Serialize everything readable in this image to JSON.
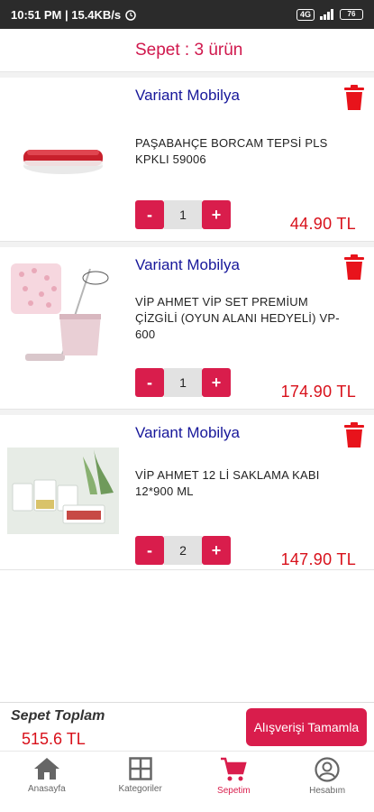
{
  "status_bar": {
    "time": "10:51 PM | 15.4KB/s",
    "network": "4G",
    "battery": "76"
  },
  "header": {
    "title": "Sepet : 3 ürün"
  },
  "cart_items": [
    {
      "seller": "Variant Mobilya",
      "name": "PAŞABAHÇE BORCAM TEPSİ PLS KPKLI 59006",
      "quantity": "1",
      "price": "44.90 TL",
      "minus_label": "-",
      "plus_label": "+"
    },
    {
      "seller": "Variant Mobilya",
      "name": "VİP AHMET VİP SET PREMİUM ÇİZGİLİ (OYUN ALANI HEDYELİ) VP-600",
      "quantity": "1",
      "price": "174.90 TL",
      "minus_label": "-",
      "plus_label": "+"
    },
    {
      "seller": "Variant Mobilya",
      "name": "VİP AHMET 12 Lİ SAKLAMA KABI 12*900 ML",
      "quantity": "2",
      "price": "147.90 TL",
      "minus_label": "-",
      "plus_label": "+"
    }
  ],
  "summary": {
    "label": "Sepet Toplam",
    "total": "515.6 TL",
    "checkout_label": "Alışverişi Tamamla"
  },
  "bottom_nav": [
    {
      "label": "Anasayfa",
      "icon": "home-icon"
    },
    {
      "label": "Kategoriler",
      "icon": "grid-icon"
    },
    {
      "label": "Sepetim",
      "icon": "cart-icon",
      "active": true
    },
    {
      "label": "Hesabım",
      "icon": "account-icon"
    }
  ],
  "colors": {
    "accent": "#d91d4c",
    "price": "#d8101a",
    "seller": "#17179a",
    "statusbar": "#2b2b2b"
  }
}
